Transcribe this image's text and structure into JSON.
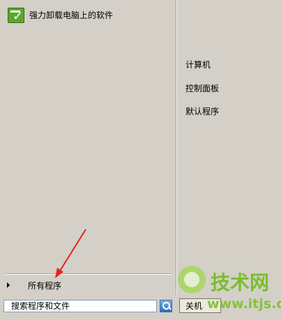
{
  "left_panel": {
    "pinned_item": {
      "label": "强力卸载电脑上的软件",
      "icon": "uninstall-app-icon"
    },
    "all_programs_label": "所有程序",
    "search": {
      "placeholder": "搜索程序和文件"
    }
  },
  "right_panel": {
    "links": [
      "计算机",
      "控制面板",
      "默认程序"
    ]
  },
  "shutdown": {
    "label": "关机"
  },
  "watermark": {
    "title": "技术网",
    "url": "www.itjs.cn"
  },
  "colors": {
    "panel_bg": "#d4d0c8",
    "annotation_arrow": "#e8221b",
    "watermark_green": "#7bbd2c"
  }
}
